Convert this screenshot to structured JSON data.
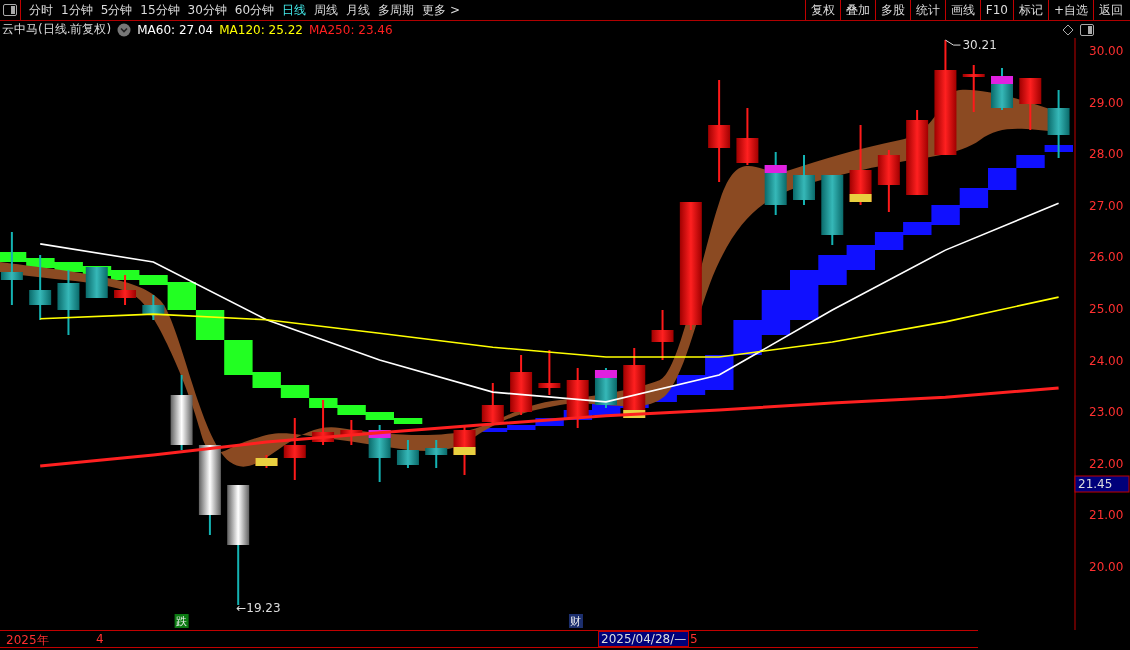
{
  "toolbar": {
    "periods": [
      {
        "label": "分时",
        "selected": false
      },
      {
        "label": "1分钟",
        "selected": false
      },
      {
        "label": "5分钟",
        "selected": false
      },
      {
        "label": "15分钟",
        "selected": false
      },
      {
        "label": "30分钟",
        "selected": false
      },
      {
        "label": "60分钟",
        "selected": false
      },
      {
        "label": "日线",
        "selected": true
      },
      {
        "label": "周线",
        "selected": false
      },
      {
        "label": "月线",
        "selected": false
      },
      {
        "label": "多周期",
        "selected": false
      },
      {
        "label": "更多 >",
        "selected": false
      }
    ],
    "buttons": [
      "复权",
      "叠加",
      "多股",
      "统计",
      "画线",
      "F10",
      "标记",
      "+自选",
      "返回"
    ]
  },
  "legend": {
    "title": "云中马(日线.前复权)",
    "values": [
      "27.04",
      "25.22",
      "23.46"
    ]
  },
  "chart_data": {
    "type": "line",
    "categories": [
      null,
      null,
      null,
      null,
      null,
      null,
      null,
      null,
      null,
      null
    ],
    "ylim": [
      18.78,
      30.25
    ],
    "yticks": [
      {
        "value": 20,
        "label": "20.00"
      },
      {
        "value": 21,
        "label": "21.00"
      },
      {
        "value": 22,
        "label": "22.00"
      },
      {
        "value": 23,
        "label": "23.00"
      },
      {
        "value": 24,
        "label": "24.00"
      },
      {
        "value": 25,
        "label": "25.00"
      },
      {
        "value": 26,
        "label": "26.00"
      },
      {
        "value": 27,
        "label": "27.00"
      },
      {
        "value": 28,
        "label": "28.00"
      },
      {
        "value": 29,
        "label": "29.00"
      },
      {
        "value": 30,
        "label": "30.00"
      }
    ],
    "series": [
      {
        "name": "MA60:",
        "color": "#ffffff",
        "values": [
          26.26,
          25.91,
          24.79,
          24.01,
          23.39,
          23.2,
          23.72,
          24.98,
          26.14,
          27.05
        ]
      },
      {
        "name": "MA120:",
        "color": "#ffff00",
        "values": [
          24.81,
          24.9,
          24.79,
          24.53,
          24.26,
          24.07,
          24.07,
          24.36,
          24.75,
          25.23
        ]
      },
      {
        "name": "MA250:",
        "color": "#ff2020",
        "values": [
          21.96,
          22.17,
          22.42,
          22.6,
          22.77,
          22.93,
          23.04,
          23.18,
          23.29,
          23.47
        ]
      }
    ]
  },
  "high_label": "30.21",
  "low_label": "←19.23",
  "events": [
    {
      "text": "跌",
      "color": "#0b7a12"
    },
    {
      "text": "财",
      "color": "#1c2f6e"
    }
  ],
  "price_tag": "21.45",
  "time_axis": [
    {
      "text": "2025年",
      "selected": false
    },
    {
      "text": "4",
      "selected": false
    },
    {
      "text": "2025/04/28/—",
      "selected": true
    },
    {
      "text": "5",
      "selected": false
    }
  ]
}
